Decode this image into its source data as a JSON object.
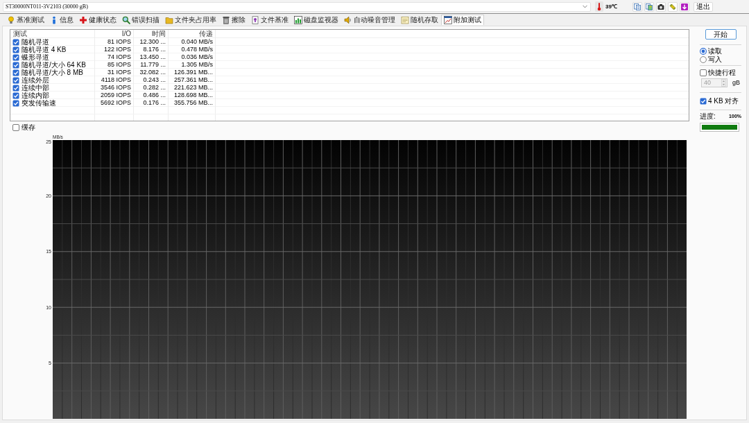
{
  "toolbar": {
    "drive": "ST30000NT011-3V2103 (30000 gB)",
    "temperature": "39℃",
    "exit_button": "退出"
  },
  "tabs": [
    {
      "label": "基准测试",
      "selected": false
    },
    {
      "label": "信息",
      "selected": false
    },
    {
      "label": "健康状态",
      "selected": false
    },
    {
      "label": "错误扫描",
      "selected": false
    },
    {
      "label": "文件夹占用率",
      "selected": false
    },
    {
      "label": "擦除",
      "selected": false
    },
    {
      "label": "文件基准",
      "selected": false
    },
    {
      "label": "磁盘监视器",
      "selected": false
    },
    {
      "label": "自动噪音管理",
      "selected": false
    },
    {
      "label": "随机存取",
      "selected": false
    },
    {
      "label": "附加测试",
      "selected": true
    }
  ],
  "test_table": {
    "columns": [
      "测试",
      "I/O",
      "时间",
      "传递"
    ],
    "rows": [
      {
        "checked": true,
        "cells": [
          "随机寻道",
          "81 IOPS",
          "12.300 ...",
          "0.040 MB/s"
        ]
      },
      {
        "checked": true,
        "cells": [
          "随机寻道 4 KB",
          "122 IOPS",
          "8.176 ...",
          "0.478 MB/s"
        ]
      },
      {
        "checked": true,
        "cells": [
          "蝶形寻道",
          "74 IOPS",
          "13.450 ...",
          "0.036 MB/s"
        ]
      },
      {
        "checked": true,
        "cells": [
          "随机寻道/大小 64 KB",
          "85 IOPS",
          "11.779 ...",
          "1.305 MB/s"
        ]
      },
      {
        "checked": true,
        "cells": [
          "随机寻道/大小 8 MB",
          "31 IOPS",
          "32.082 ...",
          "126.391 MB..."
        ]
      },
      {
        "checked": true,
        "cells": [
          "连续外层",
          "4118 IOPS",
          "0.243 ...",
          "257.361 MB..."
        ]
      },
      {
        "checked": true,
        "cells": [
          "连续中部",
          "3546 IOPS",
          "0.282 ...",
          "221.623 MB..."
        ]
      },
      {
        "checked": true,
        "cells": [
          "连续内部",
          "2059 IOPS",
          "0.486 ...",
          "128.698 MB..."
        ]
      },
      {
        "checked": true,
        "cells": [
          "突发传输速",
          "5692 IOPS",
          "0.176 ...",
          "355.756 MB..."
        ]
      }
    ]
  },
  "cache_checkbox": {
    "label": "缓存",
    "checked": false
  },
  "graph": {
    "unit": "MB/s",
    "y_labels": [
      "25",
      "20",
      "15",
      "10",
      "5"
    ]
  },
  "side_panel": {
    "start_button": "开始",
    "mode_options": [
      {
        "label": "读取",
        "selected": true
      },
      {
        "label": "写入",
        "selected": false
      }
    ],
    "quick_stroke": {
      "label": "快捷行程",
      "checked": false
    },
    "stroke_size": {
      "value": "40",
      "unit": "gB",
      "disabled": true
    },
    "align_4kb": {
      "label": "4 KB 对齐",
      "checked": true
    },
    "progress": {
      "label": "进度:",
      "reading": "100%",
      "level": 1
    }
  }
}
